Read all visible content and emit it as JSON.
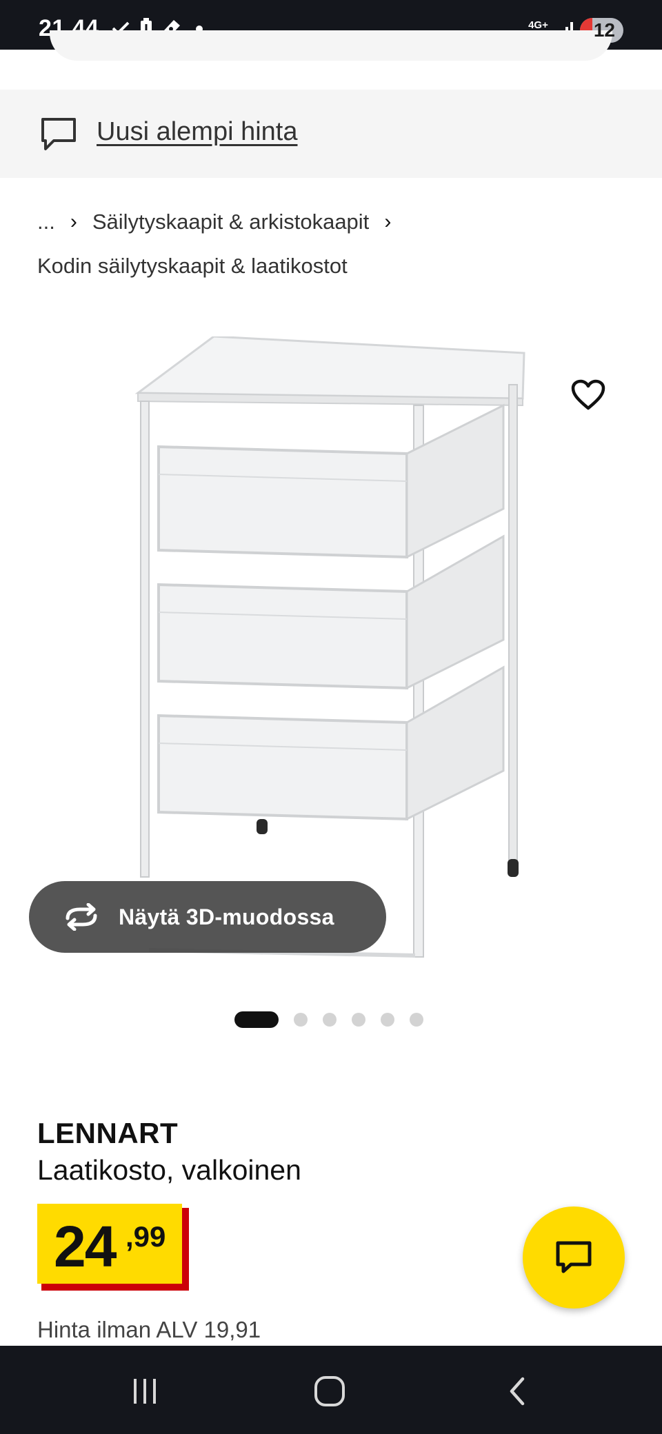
{
  "status_bar": {
    "time": "21.44",
    "network": "4G+",
    "battery": "12",
    "icons": [
      "download-done-icon",
      "battery-alert-icon",
      "pen-icon",
      "notification-dot-icon",
      "signal-icon"
    ]
  },
  "banner": {
    "icon": "chat-bubble-icon",
    "link_text": "Uusi alempi hinta"
  },
  "breadcrumb": {
    "ellipsis": "...",
    "item1": "Säilytyskaapit & arkistokaapit",
    "item2": "Kodin säilytyskaapit & laatikostot"
  },
  "gallery": {
    "favourite_icon": "heart-icon",
    "view_3d_label": "Näytä 3D-muodossa",
    "image_count": 6,
    "active_index": 0
  },
  "product": {
    "name": "LENNART",
    "description": "Laatikosto, valkoinen",
    "price_integer": "24",
    "price_decimal": ",99",
    "price_no_vat": "Hinta ilman ALV 19,91"
  },
  "chat_button": {
    "icon": "chat-icon"
  },
  "nav_bar": {
    "buttons": [
      "recents-icon",
      "home-icon",
      "back-icon"
    ]
  },
  "colors": {
    "accent_yellow": "#ffdb00",
    "price_red": "#cc0008",
    "system_bar": "#14161c",
    "banner_bg": "#f5f5f5"
  }
}
